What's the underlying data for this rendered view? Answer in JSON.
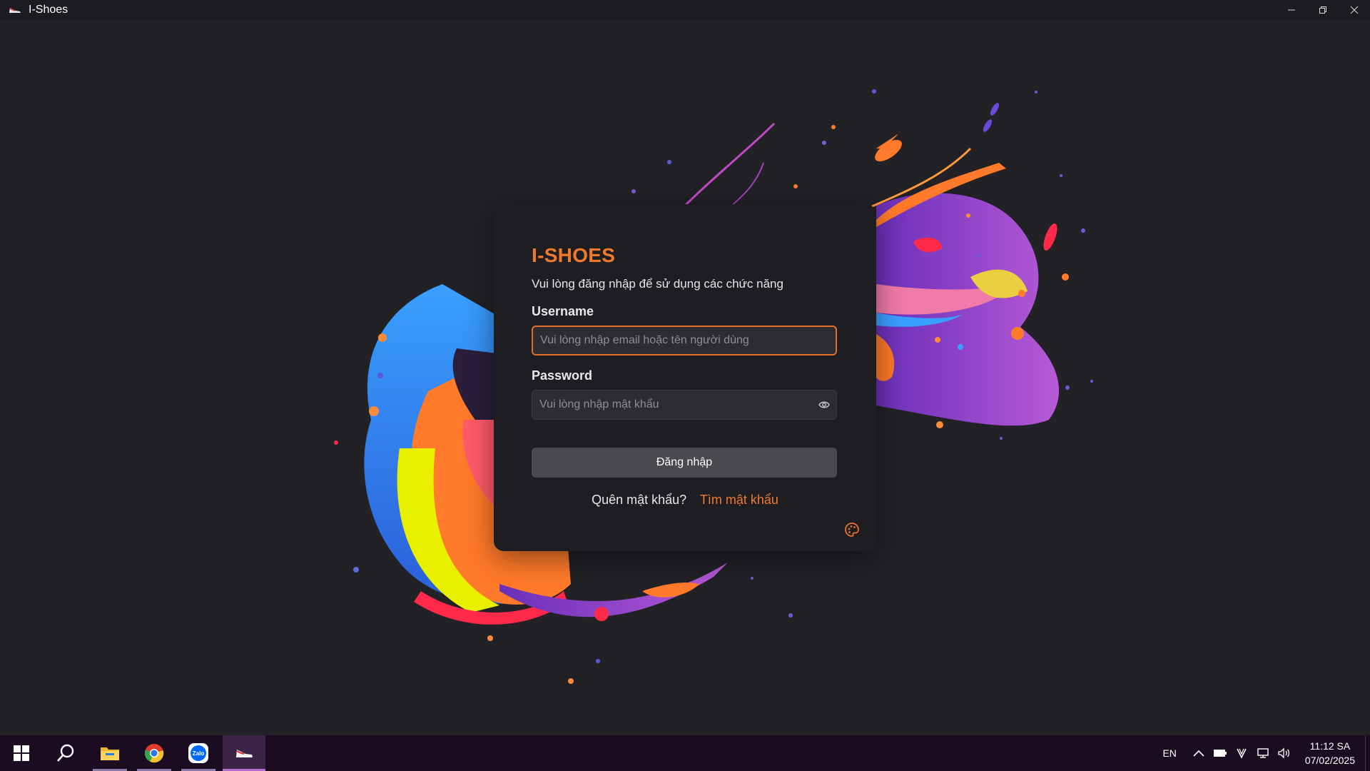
{
  "window": {
    "title": "I-Shoes",
    "controls": {
      "minimize": "minimize-icon",
      "restore": "restore-icon",
      "close": "close-icon"
    }
  },
  "login": {
    "brand": "I-SHOES",
    "subtitle": "Vui lòng đăng nhập để sử dụng các chức năng",
    "username_label": "Username",
    "username_value": "",
    "username_placeholder": "Vui lòng nhập email hoặc tên người dùng",
    "password_label": "Password",
    "password_value": "",
    "password_placeholder": "Vui lòng nhập mật khẩu",
    "submit_label": "Đăng nhập",
    "forgot_question": "Quên mật khẩu?",
    "forgot_link": "Tìm mật khẩu",
    "accent_color": "#f07a2c"
  },
  "taskbar": {
    "apps": [
      "windows-start",
      "search",
      "file-explorer",
      "chrome",
      "zalo",
      "i-shoes"
    ],
    "zalo_label": "Zalo",
    "language": "EN",
    "time": "11:12 SA",
    "date": "07/02/2025"
  }
}
